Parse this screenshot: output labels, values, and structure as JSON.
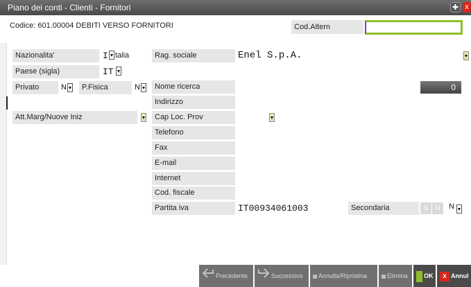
{
  "window": {
    "title": "Piano dei conti - Clienti - Fornitori"
  },
  "header": {
    "code_text": "Codice: 601.00004 DEBITI VERSO FORNITORI",
    "cod_altern_label": "Cod.Altern",
    "cod_altern_value": ""
  },
  "left": {
    "nazionalita_label": "Nazionalita'",
    "nazionalita_value": "I",
    "nazionalita_desc": "talia",
    "paese_label": "Paese (sigla)",
    "paese_value": "IT",
    "privato_label": "Privato",
    "privato_value": "N",
    "pfisica_label": "P.Fisica",
    "pfisica_value": "N",
    "attmarg_label": "Att.Marg/Nuove Iniz"
  },
  "right": {
    "rag_sociale_label": "Rag. sociale",
    "rag_sociale_value": "Enel S.p.A.",
    "nome_ricerca_label": "Nome ricerca",
    "nome_ricerca_value": "",
    "counter_value": "0",
    "indirizzo_label": "Indirizzo",
    "cap_label": "Cap Loc. Prov",
    "telefono_label": "Telefono",
    "fax_label": "Fax",
    "email_label": "E-mail",
    "internet_label": "Internet",
    "cod_fiscale_label": "Cod. fiscale",
    "partita_iva_label": "Partita iva",
    "partita_iva_value": "IT00934061003",
    "secondaria_label": "Secondaria",
    "secondaria_s": "S",
    "secondaria_n": "N",
    "secondaria_value": "N"
  },
  "buttons": {
    "precedente": "Precedente",
    "successivo": "Successivo",
    "annulla_ripristina": "Annulla/Ripristina",
    "elimina": "Elimina",
    "ok": "OK",
    "annulla": "Annul"
  },
  "colors": {
    "accent_green": "#8fbe2a",
    "close_red": "#d9261c"
  }
}
